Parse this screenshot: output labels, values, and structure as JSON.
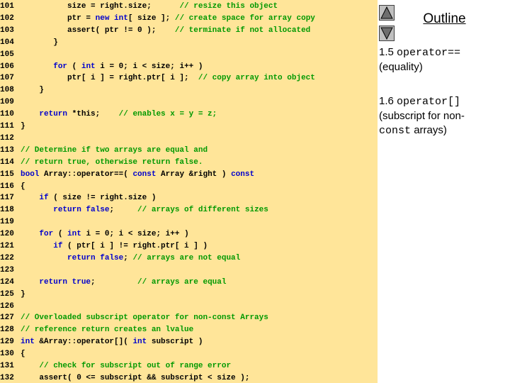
{
  "colors": {
    "code_background": "#ffe599",
    "keyword": "#0000cc",
    "comment": "#009900",
    "text": "#000000"
  },
  "nav": {
    "up_icon": "triangle-up-icon",
    "down_icon": "triangle-down-icon"
  },
  "outline": {
    "title": "Outline"
  },
  "notes": [
    {
      "num": "1.5",
      "code": "operator==",
      "text": "(equality)"
    },
    {
      "num": "1.6",
      "code": "operator[]",
      "text": "(subscript for non-",
      "code2": "const",
      "text2": "arrays)"
    }
  ],
  "code_lines": [
    {
      "n": "101",
      "segs": [
        [
          "plain",
          "          size = right.size;      "
        ],
        [
          "cm",
          "// resize this object"
        ]
      ]
    },
    {
      "n": "102",
      "segs": [
        [
          "plain",
          "          ptr = "
        ],
        [
          "kw",
          "new int"
        ],
        [
          "plain",
          "[ size ]; "
        ],
        [
          "cm",
          "// create space for array copy"
        ]
      ]
    },
    {
      "n": "103",
      "segs": [
        [
          "plain",
          "          assert( ptr != 0 );    "
        ],
        [
          "cm",
          "// terminate if not allocated"
        ]
      ]
    },
    {
      "n": "104",
      "segs": [
        [
          "plain",
          "       }"
        ]
      ]
    },
    {
      "n": "105",
      "segs": []
    },
    {
      "n": "106",
      "segs": [
        [
          "plain",
          "       "
        ],
        [
          "kw",
          "for"
        ],
        [
          "plain",
          " ( "
        ],
        [
          "kw",
          "int"
        ],
        [
          "plain",
          " i = 0; i < size; i++ )"
        ]
      ]
    },
    {
      "n": "107",
      "segs": [
        [
          "plain",
          "          ptr[ i ] = right.ptr[ i ];  "
        ],
        [
          "cm",
          "// copy array into object"
        ]
      ]
    },
    {
      "n": "108",
      "segs": [
        [
          "plain",
          "    }"
        ]
      ]
    },
    {
      "n": "109",
      "segs": []
    },
    {
      "n": "110",
      "segs": [
        [
          "plain",
          "    "
        ],
        [
          "kw",
          "return"
        ],
        [
          "plain",
          " *this;    "
        ],
        [
          "cm",
          "// enables x = y = z;"
        ]
      ]
    },
    {
      "n": "111",
      "segs": [
        [
          "plain",
          "}"
        ]
      ]
    },
    {
      "n": "112",
      "segs": []
    },
    {
      "n": "113",
      "segs": [
        [
          "cm",
          "// Determine if two arrays are equal and"
        ]
      ]
    },
    {
      "n": "114",
      "segs": [
        [
          "cm",
          "// return true, otherwise return false."
        ]
      ]
    },
    {
      "n": "115",
      "segs": [
        [
          "kw",
          "bool"
        ],
        [
          "plain",
          " Array::operator==( "
        ],
        [
          "kw",
          "const"
        ],
        [
          "plain",
          " Array &right ) "
        ],
        [
          "kw",
          "const"
        ]
      ]
    },
    {
      "n": "116",
      "segs": [
        [
          "plain",
          "{"
        ]
      ]
    },
    {
      "n": "117",
      "segs": [
        [
          "plain",
          "    "
        ],
        [
          "kw",
          "if"
        ],
        [
          "plain",
          " ( size != right.size )"
        ]
      ]
    },
    {
      "n": "118",
      "segs": [
        [
          "plain",
          "       "
        ],
        [
          "kw",
          "return false"
        ],
        [
          "plain",
          ";     "
        ],
        [
          "cm",
          "// arrays of different sizes"
        ]
      ]
    },
    {
      "n": "119",
      "segs": []
    },
    {
      "n": "120",
      "segs": [
        [
          "plain",
          "    "
        ],
        [
          "kw",
          "for"
        ],
        [
          "plain",
          " ( "
        ],
        [
          "kw",
          "int"
        ],
        [
          "plain",
          " i = 0; i < size; i++ )"
        ]
      ]
    },
    {
      "n": "121",
      "segs": [
        [
          "plain",
          "       "
        ],
        [
          "kw",
          "if"
        ],
        [
          "plain",
          " ( ptr[ i ] != right.ptr[ i ] )"
        ]
      ]
    },
    {
      "n": "122",
      "segs": [
        [
          "plain",
          "          "
        ],
        [
          "kw",
          "return false"
        ],
        [
          "plain",
          "; "
        ],
        [
          "cm",
          "// arrays are not equal"
        ]
      ]
    },
    {
      "n": "123",
      "segs": []
    },
    {
      "n": "124",
      "segs": [
        [
          "plain",
          "    "
        ],
        [
          "kw",
          "return true"
        ],
        [
          "plain",
          ";         "
        ],
        [
          "cm",
          "// arrays are equal"
        ]
      ]
    },
    {
      "n": "125",
      "segs": [
        [
          "plain",
          "}"
        ]
      ]
    },
    {
      "n": "126",
      "segs": []
    },
    {
      "n": "127",
      "segs": [
        [
          "cm",
          "// Overloaded subscript operator for non-const Arrays"
        ]
      ]
    },
    {
      "n": "128",
      "segs": [
        [
          "cm",
          "// reference return creates an lvalue"
        ]
      ]
    },
    {
      "n": "129",
      "segs": [
        [
          "kw",
          "int"
        ],
        [
          "plain",
          " &Array::operator[]( "
        ],
        [
          "kw",
          "int"
        ],
        [
          "plain",
          " subscript )"
        ]
      ]
    },
    {
      "n": "130",
      "segs": [
        [
          "plain",
          "{"
        ]
      ]
    },
    {
      "n": "131",
      "segs": [
        [
          "plain",
          "    "
        ],
        [
          "cm",
          "// check for subscript out of range error"
        ]
      ]
    },
    {
      "n": "132",
      "segs": [
        [
          "plain",
          "    assert( 0 <= subscript && subscript < size );"
        ]
      ]
    }
  ]
}
